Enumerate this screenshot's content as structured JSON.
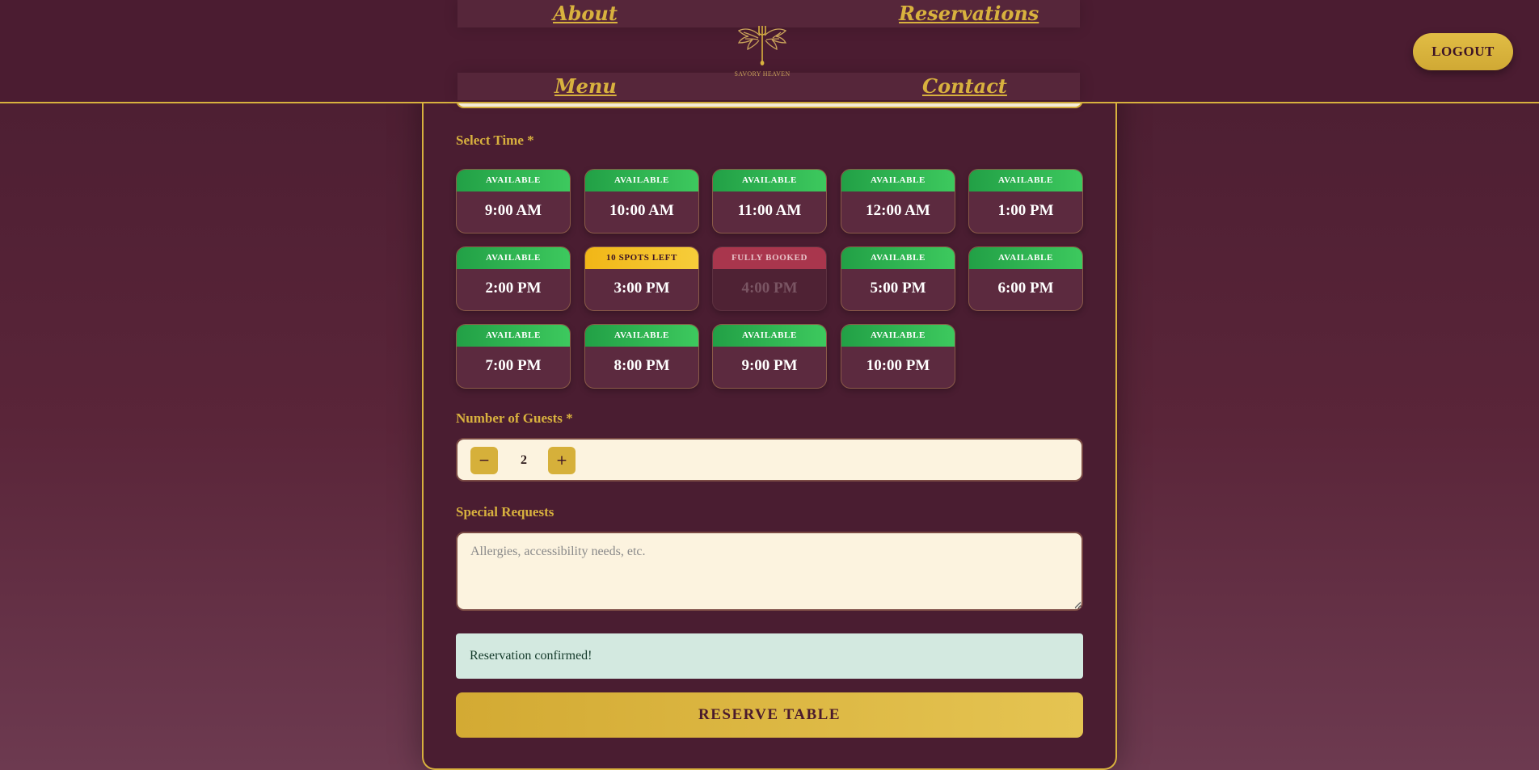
{
  "header": {
    "nav": {
      "about": "About",
      "reservations": "Reservations",
      "menu": "Menu",
      "contact": "Contact"
    },
    "logo_text": "SAVORY HEAVEN",
    "logout_label": "LOGOUT"
  },
  "form": {
    "time_label": "Select Time *",
    "slots": [
      {
        "status": "AVAILABLE",
        "time": "9:00 AM",
        "state": "available"
      },
      {
        "status": "AVAILABLE",
        "time": "10:00 AM",
        "state": "available"
      },
      {
        "status": "AVAILABLE",
        "time": "11:00 AM",
        "state": "available"
      },
      {
        "status": "AVAILABLE",
        "time": "12:00 AM",
        "state": "available"
      },
      {
        "status": "AVAILABLE",
        "time": "1:00 PM",
        "state": "available"
      },
      {
        "status": "AVAILABLE",
        "time": "2:00 PM",
        "state": "available"
      },
      {
        "status": "10 SPOTS LEFT",
        "time": "3:00 PM",
        "state": "limited"
      },
      {
        "status": "FULLY BOOKED",
        "time": "4:00 PM",
        "state": "booked"
      },
      {
        "status": "AVAILABLE",
        "time": "5:00 PM",
        "state": "available"
      },
      {
        "status": "AVAILABLE",
        "time": "6:00 PM",
        "state": "available"
      },
      {
        "status": "AVAILABLE",
        "time": "7:00 PM",
        "state": "available"
      },
      {
        "status": "AVAILABLE",
        "time": "8:00 PM",
        "state": "available"
      },
      {
        "status": "AVAILABLE",
        "time": "9:00 PM",
        "state": "available"
      },
      {
        "status": "AVAILABLE",
        "time": "10:00 PM",
        "state": "available"
      }
    ],
    "guests_label": "Number of Guests *",
    "guests": {
      "minus": "−",
      "value": "2",
      "plus": "+"
    },
    "requests_label": "Special Requests",
    "requests_placeholder": "Allergies, accessibility needs, etc.",
    "message": "Reservation confirmed!",
    "submit_label": "RESERVE TABLE"
  },
  "colors": {
    "background": "#4a1d31",
    "accent_gold": "#d8b13e",
    "available_green": "#2bb34f",
    "limited_yellow": "#f3c02a",
    "booked_red": "#a9364d",
    "field_cream": "#fcf3df",
    "success_bg": "#d3e9e0"
  }
}
